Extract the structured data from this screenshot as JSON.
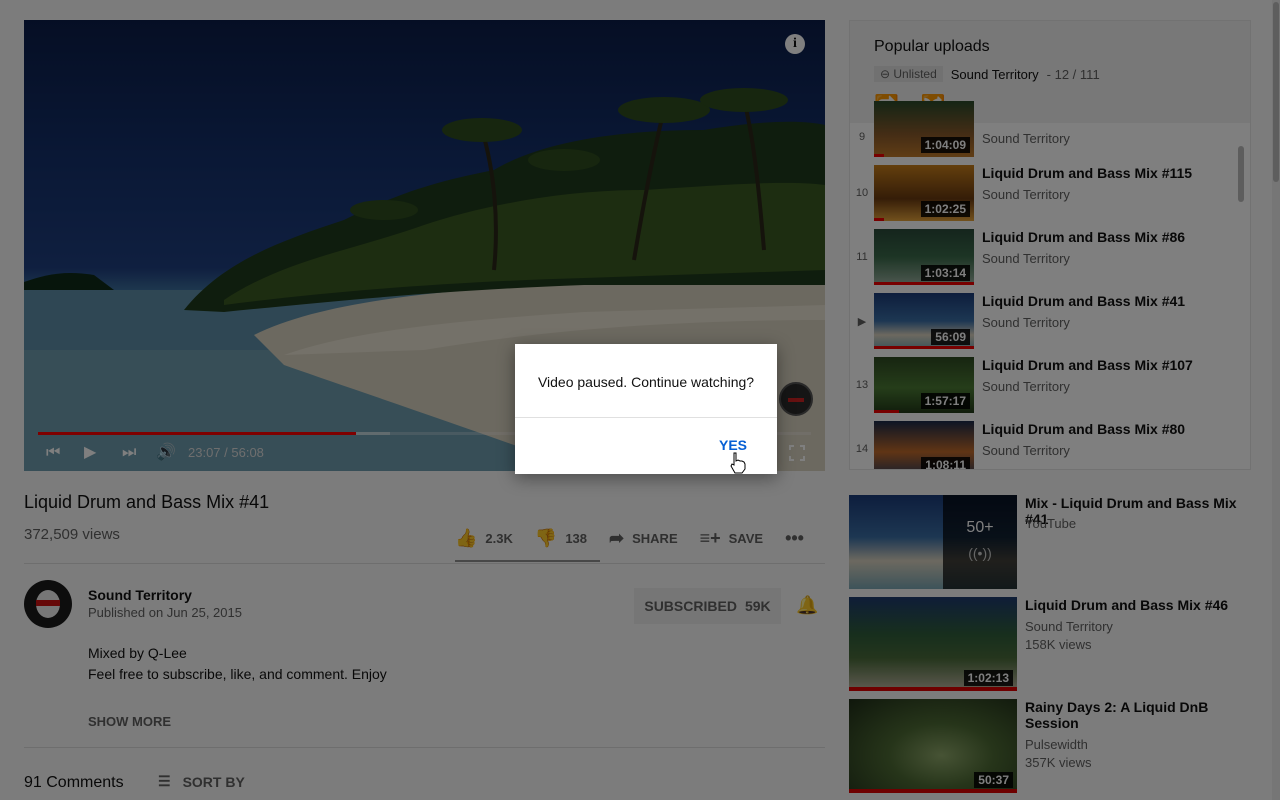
{
  "player": {
    "time_display": "23:07 / 56:08",
    "played_fraction": 0.412,
    "buffered_fraction": 0.455,
    "info_icon": "info-icon",
    "controls": [
      "previous-icon",
      "play-icon",
      "next-icon",
      "volume-icon",
      "fullscreen-icon"
    ]
  },
  "video": {
    "title": "Liquid Drum and Bass Mix #41",
    "views": "372,509 views",
    "likes": "2.3K",
    "dislikes": "138",
    "share_label": "SHARE",
    "save_label": "SAVE",
    "like_ratio": 0.94
  },
  "channel": {
    "name": "Sound Territory",
    "published": "Published on Jun 25, 2015",
    "subscribe_label": "SUBSCRIBED",
    "subscriber_count": "59K"
  },
  "description": {
    "lines": [
      "Mixed by Q-Lee",
      "Feel free to subscribe, like, and comment. Enjoy"
    ],
    "show_more": "SHOW MORE"
  },
  "comments": {
    "count": "91 Comments",
    "sort_label": "SORT BY"
  },
  "playlist": {
    "title": "Popular uploads",
    "unlisted_label": "Unlisted",
    "channel": "Sound Territory",
    "position": "- 12 / 111",
    "items": [
      {
        "num": "9",
        "title": "",
        "channel": "Sound Territory",
        "duration": "1:04:09",
        "watched": 0.1
      },
      {
        "num": "10",
        "title": "Liquid Drum and Bass Mix #115",
        "channel": "Sound Territory",
        "duration": "1:02:25",
        "watched": 0.1
      },
      {
        "num": "11",
        "title": "Liquid Drum and Bass Mix #86",
        "channel": "Sound Territory",
        "duration": "1:03:14",
        "watched": 1.0
      },
      {
        "num": "▶",
        "title": "Liquid Drum and Bass Mix #41",
        "channel": "Sound Territory",
        "duration": "56:09",
        "watched": 1.0
      },
      {
        "num": "13",
        "title": "Liquid Drum and Bass Mix #107",
        "channel": "Sound Territory",
        "duration": "1:57:17",
        "watched": 0.25
      },
      {
        "num": "14",
        "title": "Liquid Drum and Bass Mix #80",
        "channel": "Sound Territory",
        "duration": "1:08:11",
        "watched": 0.0
      }
    ]
  },
  "recommendations": [
    {
      "title": "Mix - Liquid Drum and Bass Mix #41",
      "channel": "YouTube",
      "views": "",
      "mix_count": "50+",
      "mix_icon": "((•))"
    },
    {
      "title": "Liquid Drum and Bass Mix #46",
      "channel": "Sound Territory",
      "views": "158K views",
      "duration": "1:02:13"
    },
    {
      "title": "Rainy Days 2: A Liquid DnB Session",
      "channel": "Pulsewidth",
      "views": "357K views",
      "duration": "50:37"
    }
  ],
  "dialog": {
    "message": "Video paused. Continue watching?",
    "confirm_label": "YES"
  },
  "colors": {
    "progress_red": "#ff0000",
    "link_blue": "#065fd4"
  }
}
